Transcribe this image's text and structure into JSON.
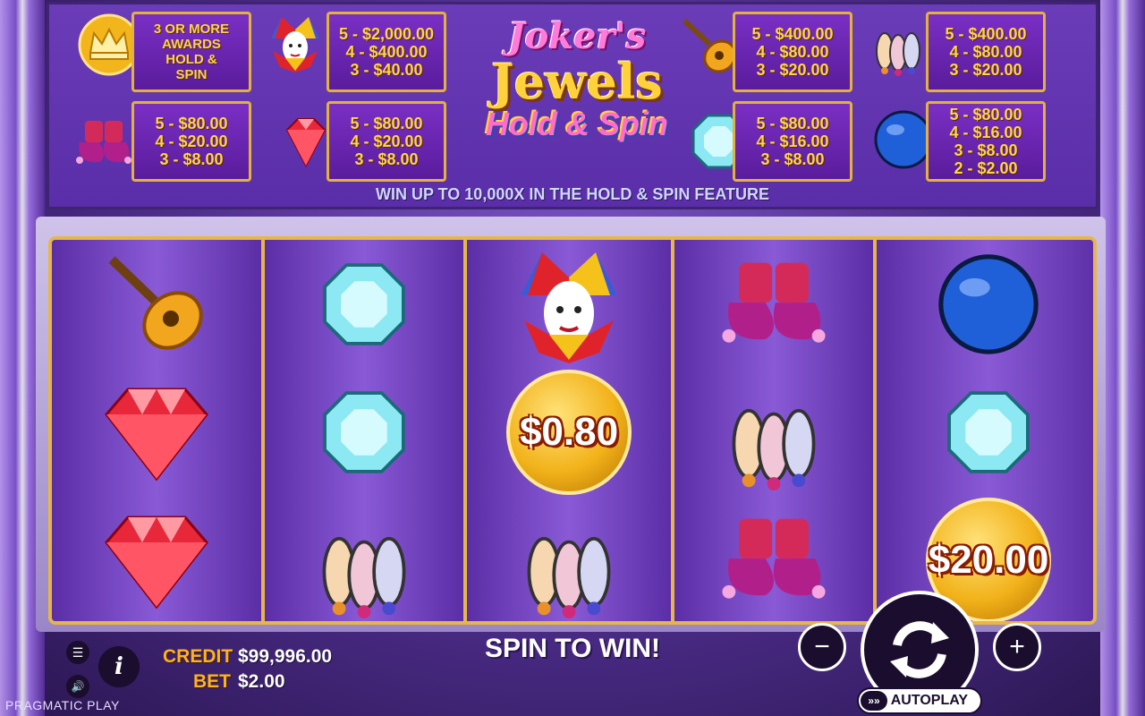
{
  "paytable": {
    "awards_lines": [
      "3 OR MORE",
      "AWARDS",
      "HOLD &",
      "SPIN"
    ],
    "joker_pays": [
      "5 - $2,000.00",
      "4 - $400.00",
      "3 - $40.00"
    ],
    "lute_pays": [
      "5 - $400.00",
      "4 - $80.00",
      "3 - $20.00"
    ],
    "pins_pays": [
      "5 - $400.00",
      "4 - $80.00",
      "3 - $20.00"
    ],
    "shoes_pays": [
      "5 - $80.00",
      "4 - $20.00",
      "3 - $8.00"
    ],
    "ruby_pays": [
      "5 - $80.00",
      "4 - $20.00",
      "3 - $8.00"
    ],
    "diamond_pays": [
      "5 - $80.00",
      "4 - $16.00",
      "3 - $8.00"
    ],
    "orb_pays": [
      "5 - $80.00",
      "4 - $16.00",
      "3 - $8.00",
      "2 - $2.00"
    ],
    "tagline": "WIN UP TO 10,000X IN THE HOLD & SPIN FEATURE"
  },
  "logo": {
    "line1": "Joker's",
    "line2": "Jewels",
    "line3": "Hold & Spin"
  },
  "reels": [
    [
      "lute",
      "ruby",
      "ruby"
    ],
    [
      "diamond",
      "diamond",
      "pins"
    ],
    [
      "joker",
      "coin",
      "pins"
    ],
    [
      "shoes",
      "pins",
      "shoes"
    ],
    [
      "orb",
      "diamond",
      "coin"
    ]
  ],
  "coins": {
    "reel3": "$0.80",
    "reel5": "$20.00"
  },
  "status": {
    "credit_label": "CREDIT",
    "credit_value": "$99,996.00",
    "bet_label": "BET",
    "bet_value": "$2.00",
    "message": "SPIN TO WIN!",
    "autoplay_label": "AUTOPLAY",
    "brand": "PRAGMATIC PLAY"
  },
  "controls": {
    "minus": "−",
    "plus": "+",
    "info": "i"
  },
  "colors": {
    "gold": "#e6b646",
    "purple": "#6a3cb8",
    "accent_label": "#ffb21e"
  }
}
